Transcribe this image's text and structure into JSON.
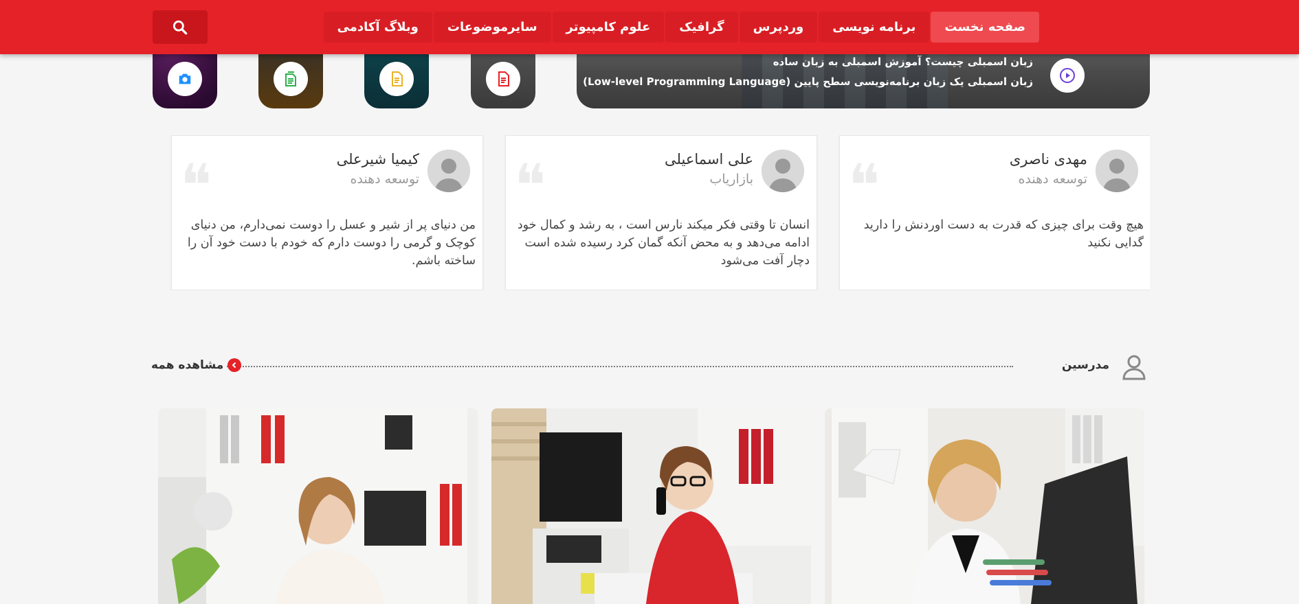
{
  "nav": {
    "items": [
      "صفحه نخست",
      "برنامه نویسی",
      "وردپرس",
      "گرافیک",
      "علوم کامپیوتر",
      "سایرموضوعات",
      "وبلاگ آکادمی"
    ],
    "active_index": 0,
    "search_icon": "search-icon"
  },
  "featured": {
    "line1": "زبان اسمبلی چیست؟ آموزش اسمبلی به زبان ساده",
    "line2": "زبان اسمبلی یک زبان برنامه‌نویسی سطح پایین (Low-level Programming Language)",
    "icon": "play-icon"
  },
  "categories": [
    {
      "icon": "pdf-file-icon",
      "icon_color": "#e52228",
      "bg": "#4a4a4a"
    },
    {
      "icon": "document-icon",
      "icon_color": "#e8b323",
      "bg": "#0f3f4a"
    },
    {
      "icon": "sheet-icon",
      "icon_color": "#2bb04a",
      "bg": "#3a2a12"
    },
    {
      "icon": "camera-icon",
      "icon_color": "#1e90ff",
      "bg": "#3a0f3e"
    }
  ],
  "testimonials": [
    {
      "name": "مهدی ناصری",
      "role": "توسعه دهنده",
      "text": "هیچ وقت برای چیزی که قدرت به دست اوردنش را دارید گدایی نکنید"
    },
    {
      "name": "علی اسماعیلی",
      "role": "بازاریاب",
      "text": "انسان تا وقتی فکر میکند نارس است ، به رشد و کمال خود ادامه می‌دهد و به محض آنکه گمان کرد رسیده شده است دچار آفت می‌شود"
    },
    {
      "name": "کیمیا شیرعلی",
      "role": "توسعه دهنده",
      "text": "من دنیای پر از شیر و عسل را دوست نمی‌دارم، من دنیای کوچک و گرمی را دوست دارم که خودم با دست خود آن را ساخته باشم."
    }
  ],
  "instructors": {
    "title": "مدرسین",
    "view_all": "مشاهده همه",
    "title_icon": "user-icon",
    "view_all_icon": "chevron-left-icon"
  },
  "colors": {
    "brand_red": "#e52228",
    "nav_item_bg": "#d81e24",
    "nav_active_bg": "#ee4a50"
  }
}
